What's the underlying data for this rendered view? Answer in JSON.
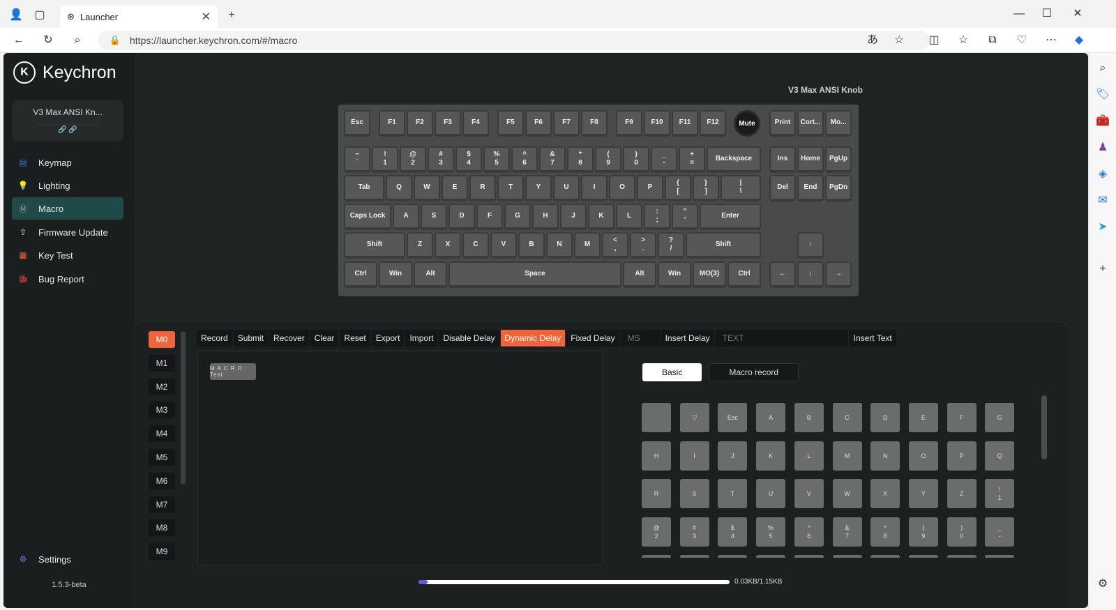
{
  "browser": {
    "tab_title": "Launcher",
    "url": "https://launcher.keychron.com/#/macro",
    "close_label": "✕",
    "new_tab_label": "+"
  },
  "app": {
    "brand": "Keychron",
    "device_name": "V3 Max ANSI Kn...",
    "device_links": "🔗          🔗",
    "nav": [
      {
        "label": "Keymap",
        "icon": "keyboard-icon",
        "color": "#2f7bd0"
      },
      {
        "label": "Lighting",
        "icon": "bulb-icon",
        "color": "#3bc46a"
      },
      {
        "label": "Macro",
        "icon": "macro-icon",
        "color": "#9aa"
      },
      {
        "label": "Firmware Update",
        "icon": "upload-icon",
        "color": "#ddd"
      },
      {
        "label": "Key Test",
        "icon": "test-icon",
        "color": "#f0643c"
      },
      {
        "label": "Bug Report",
        "icon": "bug-icon",
        "color": "#e0407a"
      }
    ],
    "settings_label": "Settings",
    "version": "1.5.3-beta"
  },
  "keyboard": {
    "name": "V3 Max ANSI Knob",
    "knob_label": "Mute"
  },
  "macro": {
    "slots": [
      "M0",
      "M1",
      "M2",
      "M3",
      "M4",
      "M5",
      "M6",
      "M7",
      "M8",
      "M9"
    ],
    "active_slot": "M0",
    "toolbar": [
      "Record",
      "Submit",
      "Recover",
      "Clear",
      "Reset",
      "Export",
      "Import",
      "Disable Delay",
      "Dynamic Delay",
      "Fixed Delay"
    ],
    "active_tool": "Dynamic Delay",
    "ms_placeholder": "MS",
    "insert_delay_label": "Insert Delay",
    "text_placeholder": "TEXT",
    "insert_text_label": "Insert Text",
    "macro_tag": "M A C R O Test",
    "panel_tabs": [
      "Basic",
      "Macro record"
    ],
    "active_panel_tab": "Basic",
    "storage_label": "0.03KB/1.15KB",
    "storage_used_fraction": 0.026
  },
  "key_grid": [
    " ",
    "▽",
    "Esc",
    "A",
    "B",
    "C",
    "D",
    "E",
    "F",
    "G",
    "H",
    "I",
    "J",
    "K",
    "L",
    "M",
    "N",
    "O",
    "P",
    "Q",
    "R",
    "S",
    "T",
    "U",
    "V",
    "W",
    "X",
    "Y",
    "Z",
    "!\n1",
    "@\n2",
    "#\n3",
    "$\n4",
    "%\n5",
    "^\n6",
    "&\n7",
    "*\n8",
    "(\n9",
    ")\n0",
    "_\n-",
    "",
    "",
    "",
    "",
    "",
    "",
    "",
    "",
    "",
    ""
  ],
  "keys": [
    [
      "Esc",
      "F1",
      "F2",
      "F3",
      "F4",
      "F5",
      "F6",
      "F7",
      "F8",
      "F9",
      "F10",
      "F11",
      "F12",
      "Print",
      "Cort...",
      "Mo..."
    ],
    [
      "~\n`",
      "!\n1",
      "@\n2",
      "#\n3",
      "$\n4",
      "%\n5",
      "^\n6",
      "&\n7",
      "*\n8",
      "(\n9",
      ")\n0",
      "_\n-",
      "+\n=",
      "Backspace",
      "Ins",
      "Home",
      "PgUp"
    ],
    [
      "Tab",
      "Q",
      "W",
      "E",
      "R",
      "T",
      "Y",
      "U",
      "I",
      "O",
      "P",
      "{\n[",
      "}\n]",
      "|\n\\",
      "Del",
      "End",
      "PgDn"
    ],
    [
      "Caps Lock",
      "A",
      "S",
      "D",
      "F",
      "G",
      "H",
      "J",
      "K",
      "L",
      ":\n;",
      "\"\n'",
      "Enter"
    ],
    [
      "Shift",
      "Z",
      "X",
      "C",
      "V",
      "B",
      "N",
      "M",
      "<\n,",
      ">\n.",
      "?\n/",
      "Shift",
      "↑"
    ],
    [
      "Ctrl",
      "Win",
      "Alt",
      "Space",
      "Alt",
      "Win",
      "MO(3)",
      "Ctrl",
      "←",
      "↓",
      "→"
    ]
  ]
}
